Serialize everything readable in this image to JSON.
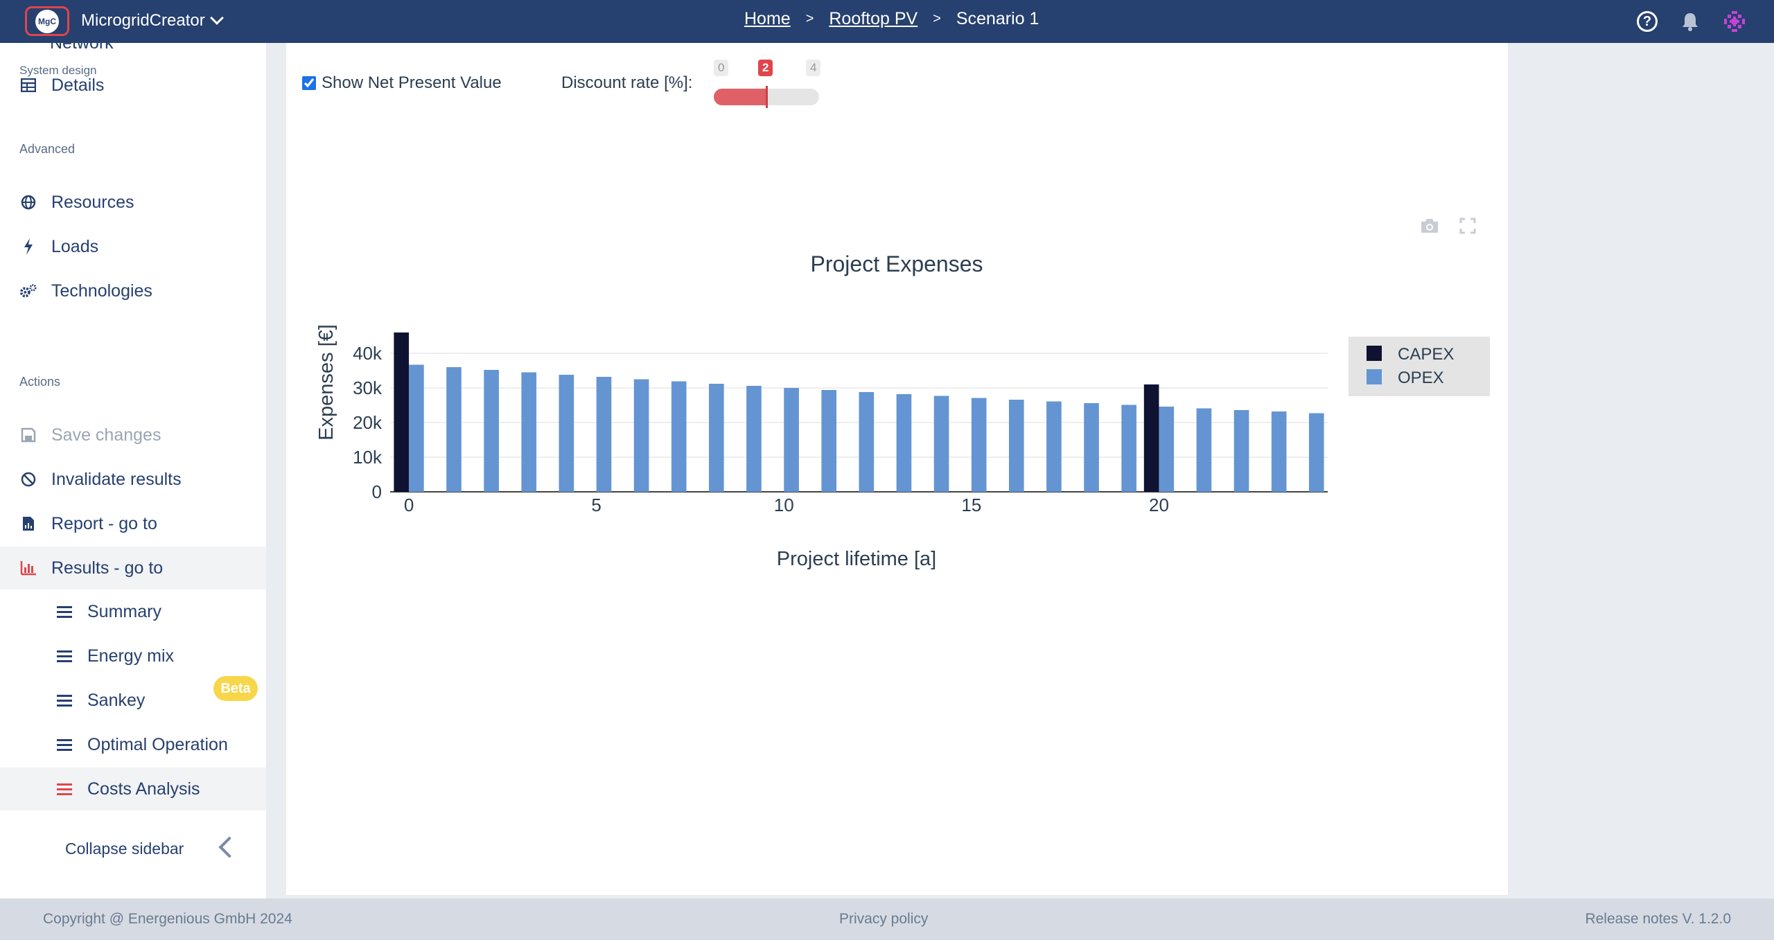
{
  "navbar": {
    "logo_text": "MgC",
    "app_name": "MicrogridCreator",
    "breadcrumb": {
      "home": "Home",
      "project": "Rooftop PV",
      "scenario": "Scenario 1",
      "sep": ">"
    }
  },
  "sidebar": {
    "cut_item": "Network",
    "system_design_label": "System design",
    "details": "Details",
    "advanced_label": "Advanced",
    "resources": "Resources",
    "loads": "Loads",
    "technologies": "Technologies",
    "actions_label": "Actions",
    "save_changes": "Save changes",
    "invalidate_results": "Invalidate results",
    "report_goto": "Report - go to",
    "results_goto": "Results - go to",
    "summary": "Summary",
    "energy_mix": "Energy mix",
    "sankey": "Sankey",
    "beta": "Beta",
    "optimal_operation": "Optimal Operation",
    "costs_analysis": "Costs Analysis",
    "collapse": "Collapse sidebar"
  },
  "controls": {
    "npv_label": "Show Net Present Value",
    "npv_checked": true,
    "discount_label": "Discount rate [%]:",
    "slider_min": "0",
    "slider_value": "2",
    "slider_max": "4",
    "slider_fraction": 0.5
  },
  "chart_data": {
    "type": "bar",
    "title": "Project Expenses",
    "xlabel": "Project lifetime [a]",
    "ylabel": "Expenses [€]",
    "x_ticks": [
      "0",
      "5",
      "10",
      "15",
      "20"
    ],
    "y_ticks": [
      "0",
      "10k",
      "20k",
      "30k",
      "40k"
    ],
    "ylim": [
      0,
      46000
    ],
    "xlim": [
      -0.5,
      24.5
    ],
    "legend_position": "right",
    "series": [
      {
        "name": "CAPEX",
        "color": "#0f1230",
        "x": [
          0,
          20
        ],
        "values": [
          46000,
          31000
        ]
      },
      {
        "name": "OPEX",
        "color": "#6495d2",
        "x": [
          0,
          1,
          2,
          3,
          4,
          5,
          6,
          7,
          8,
          9,
          10,
          11,
          12,
          13,
          14,
          15,
          16,
          17,
          18,
          19,
          20,
          21,
          22,
          23,
          24
        ],
        "values": [
          36700,
          36000,
          35200,
          34500,
          33800,
          33200,
          32500,
          31900,
          31200,
          30600,
          30000,
          29400,
          28800,
          28200,
          27700,
          27100,
          26600,
          26100,
          25600,
          25100,
          24600,
          24100,
          23600,
          23200,
          22700
        ]
      }
    ]
  },
  "footer": {
    "copyright": "Copyright @ Energenious GmbH 2024",
    "privacy": "Privacy policy",
    "release": "Release notes V. 1.2.0"
  }
}
